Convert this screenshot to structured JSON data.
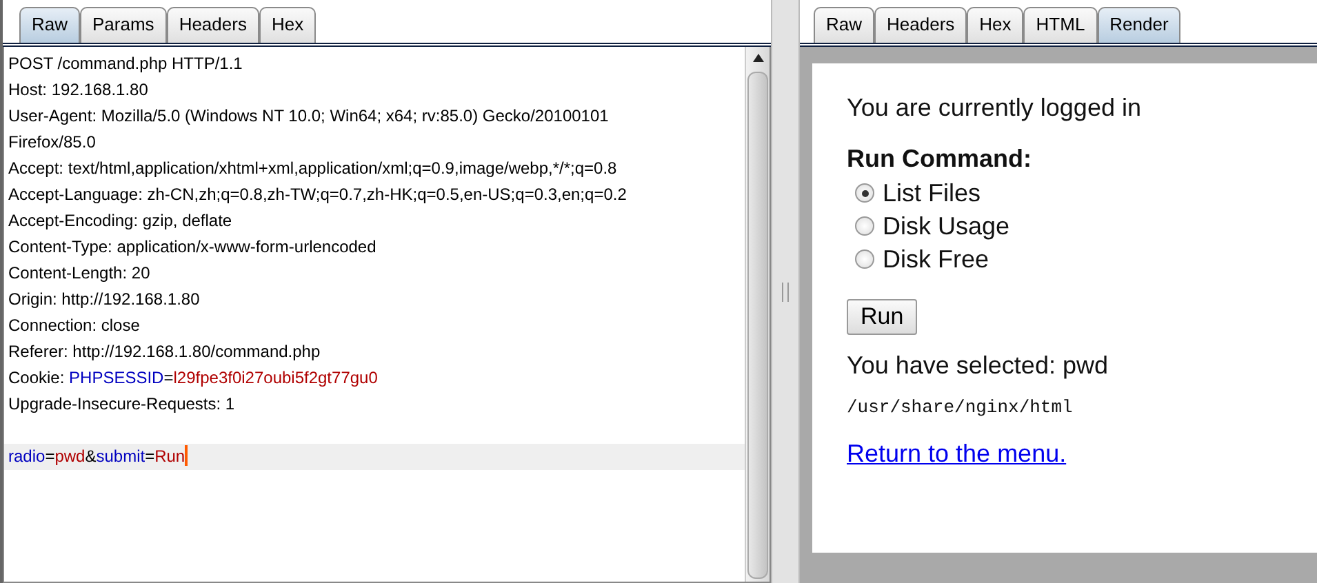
{
  "request": {
    "tabs": [
      {
        "label": "Raw",
        "selected": true
      },
      {
        "label": "Params",
        "selected": false
      },
      {
        "label": "Headers",
        "selected": false
      },
      {
        "label": "Hex",
        "selected": false
      }
    ],
    "lines": [
      [
        {
          "kind": "plain",
          "text": "POST /command.php HTTP/1.1"
        }
      ],
      [
        {
          "kind": "plain",
          "text": "Host: 192.168.1.80"
        }
      ],
      [
        {
          "kind": "plain",
          "text": "User-Agent: Mozilla/5.0 (Windows NT 10.0; Win64; x64; rv:85.0) Gecko/20100101"
        }
      ],
      [
        {
          "kind": "plain",
          "text": "Firefox/85.0"
        }
      ],
      [
        {
          "kind": "plain",
          "text": "Accept: text/html,application/xhtml+xml,application/xml;q=0.9,image/webp,*/*;q=0.8"
        }
      ],
      [
        {
          "kind": "plain",
          "text": "Accept-Language: zh-CN,zh;q=0.8,zh-TW;q=0.7,zh-HK;q=0.5,en-US;q=0.3,en;q=0.2"
        }
      ],
      [
        {
          "kind": "plain",
          "text": "Accept-Encoding: gzip, deflate"
        }
      ],
      [
        {
          "kind": "plain",
          "text": "Content-Type: application/x-www-form-urlencoded"
        }
      ],
      [
        {
          "kind": "plain",
          "text": "Content-Length: 20"
        }
      ],
      [
        {
          "kind": "plain",
          "text": "Origin: http://192.168.1.80"
        }
      ],
      [
        {
          "kind": "plain",
          "text": "Connection: close"
        }
      ],
      [
        {
          "kind": "plain",
          "text": "Referer: http://192.168.1.80/command.php"
        }
      ],
      [
        {
          "kind": "plain",
          "text": "Cookie: "
        },
        {
          "kind": "name",
          "text": "PHPSESSID"
        },
        {
          "kind": "plain",
          "text": "="
        },
        {
          "kind": "value",
          "text": "l29fpe3f0i27oubi5f2gt77gu0"
        }
      ],
      [
        {
          "kind": "plain",
          "text": "Upgrade-Insecure-Requests: 1"
        }
      ]
    ],
    "body": [
      {
        "kind": "name",
        "text": "radio"
      },
      {
        "kind": "plain",
        "text": "="
      },
      {
        "kind": "value",
        "text": "pwd"
      },
      {
        "kind": "plain",
        "text": "&"
      },
      {
        "kind": "name",
        "text": "submit"
      },
      {
        "kind": "plain",
        "text": "="
      },
      {
        "kind": "value",
        "text": "Run"
      }
    ]
  },
  "response": {
    "tabs": [
      {
        "label": "Raw",
        "selected": false
      },
      {
        "label": "Headers",
        "selected": false
      },
      {
        "label": "Hex",
        "selected": false
      },
      {
        "label": "HTML",
        "selected": false
      },
      {
        "label": "Render",
        "selected": true
      }
    ],
    "page": {
      "status": "You are currently logged in",
      "heading": "Run Command:",
      "options": [
        {
          "label": "List Files",
          "selected": true
        },
        {
          "label": "Disk Usage",
          "selected": false
        },
        {
          "label": "Disk Free",
          "selected": false
        }
      ],
      "button": "Run",
      "selection": "You have selected: pwd",
      "output": "/usr/share/nginx/html",
      "link": "Return to the menu."
    }
  }
}
